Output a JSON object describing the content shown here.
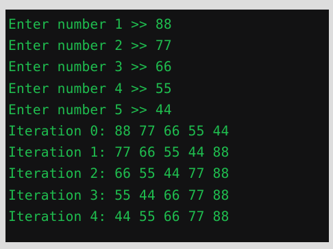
{
  "console": {
    "lines": [
      "Enter number 1 >> 88",
      "Enter number 2 >> 77",
      "Enter number 3 >> 66",
      "Enter number 4 >> 55",
      "Enter number 5 >> 44",
      "Iteration 0: 88 77 66 55 44",
      "Iteration 1: 77 66 55 44 88",
      "Iteration 2: 66 55 44 77 88",
      "Iteration 3: 55 44 66 77 88",
      "Iteration 4: 44 55 66 77 88"
    ],
    "text_color": "#1fbe4f",
    "background_color": "#121213"
  }
}
